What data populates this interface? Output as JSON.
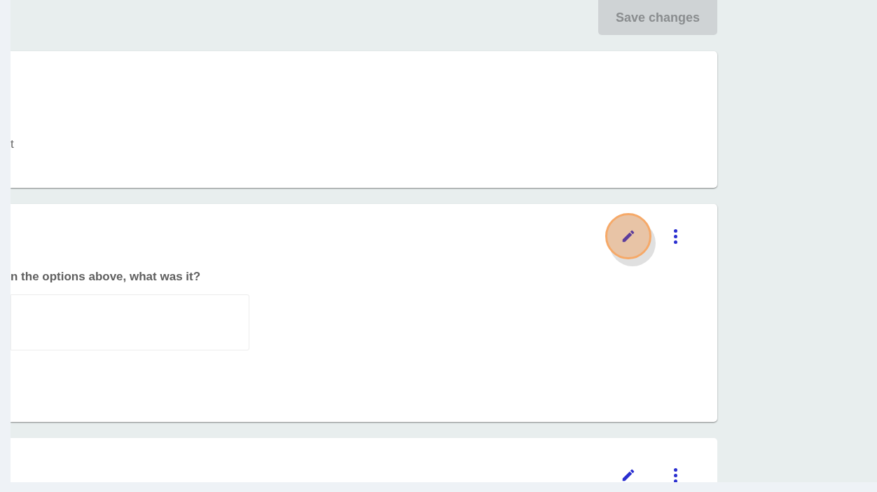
{
  "save_button": {
    "label": "Save changes",
    "disabled": true
  },
  "cards": [
    {
      "kind": "text",
      "text": "t"
    },
    {
      "kind": "question",
      "question": "n the options above, what was it?",
      "edit_highlighted": true
    },
    {
      "kind": "partial",
      "edit_highlighted": false
    }
  ]
}
